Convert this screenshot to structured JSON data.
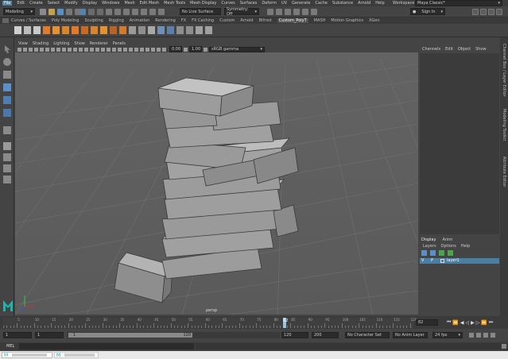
{
  "menu": {
    "items": [
      "File",
      "Edit",
      "Create",
      "Select",
      "Modify",
      "Display",
      "Windows",
      "Mesh",
      "Edit Mesh",
      "Mesh Tools",
      "Mesh Display",
      "Curves",
      "Surfaces",
      "Deform",
      "UV",
      "Generate",
      "Cache",
      "Substance",
      "Arnold",
      "Help"
    ],
    "workspace_label": "Workspace :",
    "workspace_value": "Maya Classic*"
  },
  "status_line": {
    "mode": "Modeling",
    "live_surface": "No Live Surface",
    "symmetry": "Symmetry: Off",
    "sign_in": "Sign In"
  },
  "shelf": {
    "tabs": [
      "Curves / Surfaces",
      "Poly Modeling",
      "Sculpting",
      "Rigging",
      "Animation",
      "Rendering",
      "FX",
      "FX Caching",
      "Custom",
      "Arnold",
      "Bifrost",
      "Custom_PolyT",
      "MASH",
      "Motion Graphics",
      "XGen"
    ],
    "selected_tab": "Custom_PolyT"
  },
  "viewport": {
    "menus": [
      "View",
      "Shading",
      "Lighting",
      "Show",
      "Renderer",
      "Panels"
    ],
    "field_a": "0.00",
    "field_b": "1.00",
    "colorspace": "sRGB gamma",
    "camera_label": "persp"
  },
  "channel_box": {
    "menus": [
      "Channels",
      "Edit",
      "Object",
      "Show"
    ]
  },
  "layer_editor": {
    "tabs": [
      "Display",
      "Anim"
    ],
    "menus": [
      "Layers",
      "Options",
      "Help"
    ],
    "layer_visible": "V",
    "layer_playback": "P",
    "layer_name": "layer1"
  },
  "side_tabs": [
    "Channel Box / Layer Editor",
    "Modeling Toolkit",
    "Attribute Editor"
  ],
  "timeline": {
    "ticks": [
      "5",
      "10",
      "15",
      "20",
      "25",
      "30",
      "35",
      "40",
      "45",
      "50",
      "55",
      "60",
      "65",
      "70",
      "75",
      "80",
      "85",
      "90",
      "95",
      "100",
      "105",
      "110",
      "115",
      "120"
    ],
    "marker": "82",
    "current_frame": "82"
  },
  "range": {
    "start": "1",
    "playback_start": "1",
    "slider_start": "1",
    "slider_end": "120",
    "playback_end": "120",
    "end": "200",
    "character_set": "No Character Set",
    "anim_layer": "No Anim Layer",
    "fps": "24 fps"
  },
  "command_line": {
    "label": "MEL"
  },
  "colors": {
    "accent": "#5285a6",
    "maya_logo": "#1fb5ad",
    "layer_row": "#4a7fa3"
  }
}
